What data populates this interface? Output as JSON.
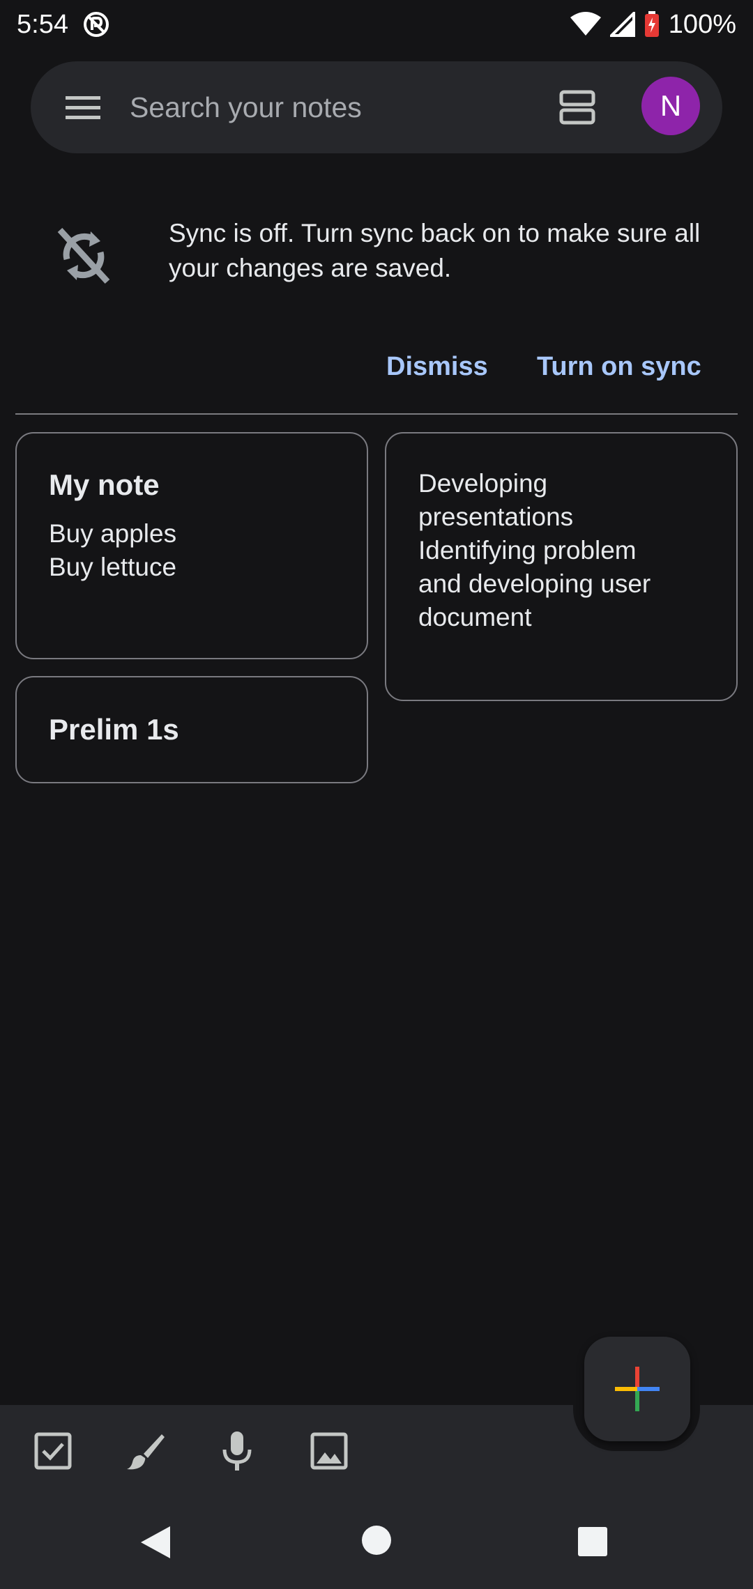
{
  "status_bar": {
    "time": "5:54",
    "battery": "100%"
  },
  "search": {
    "placeholder": "Search your notes",
    "avatar_letter": "N"
  },
  "sync_banner": {
    "message": "Sync is off. Turn sync back on to make sure all your changes are saved.",
    "dismiss_label": "Dismiss",
    "turn_on_label": "Turn on sync"
  },
  "notes": [
    {
      "title": "My note",
      "lines": [
        "Buy apples",
        "Buy lettuce"
      ]
    },
    {
      "title": "",
      "lines": [
        "Developing",
        "presentations",
        "Identifying problem",
        "and developing user",
        "document"
      ]
    },
    {
      "title": "Prelim 1s",
      "lines": []
    }
  ],
  "toolbar": {
    "icons": [
      "checkbox-icon",
      "brush-icon",
      "mic-icon",
      "image-icon"
    ],
    "fab_icon": "plus-icon"
  },
  "colors": {
    "accent": "#a8c7fa",
    "avatar": "#8e24aa",
    "background": "#141416",
    "surface": "#26272b"
  }
}
